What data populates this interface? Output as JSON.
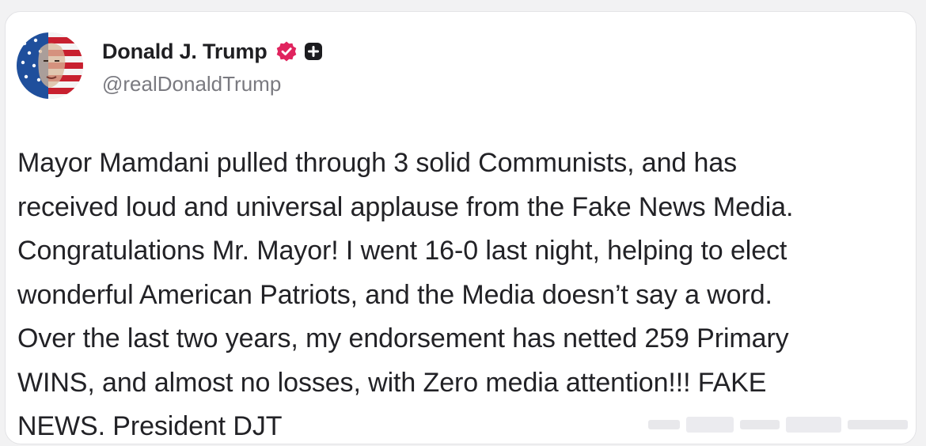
{
  "post": {
    "author_name": "Donald J. Trump",
    "handle": "@realDonaldTrump",
    "verified_icon": "verified-badge-icon",
    "badge_icon": "plus-badge-icon",
    "avatar_icon": "profile-avatar",
    "verified_color": "#e0245e",
    "body": "Mayor Mamdani pulled through 3 solid Communists, and has\nreceived loud and universal applause from the Fake News Media.\nCongratulations Mr. Mayor! I went 16-0 last night, helping to elect\nwonderful American Patriots, and the Media doesn’t say a word.\nOver the last two years, my endorsement has netted 259 Primary\nWINS, and almost no losses, with Zero media attention!!! FAKE\nNEWS. President DJT"
  }
}
